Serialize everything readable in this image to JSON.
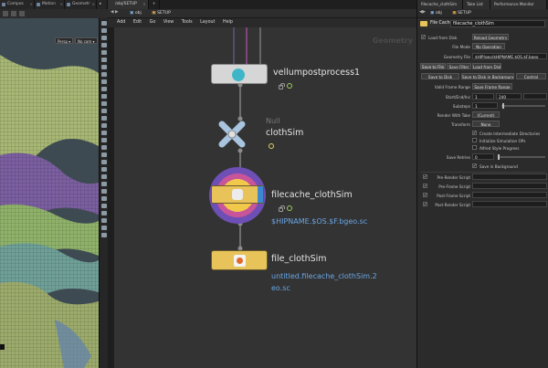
{
  "viewport": {
    "tabs": [
      {
        "label": "Compos"
      },
      {
        "label": "Motion"
      },
      {
        "label": "Geometr"
      }
    ],
    "persp_label": "Persp",
    "camera_label": "No cam",
    "colors": {
      "bg": "#3f4a52",
      "cloth_green": "#9bb067",
      "cloth_teal": "#6fa098",
      "cloth_purple": "#7b5fa0",
      "cloth_blue": "#5f80b0"
    }
  },
  "network": {
    "tabs": [
      {
        "label": "/obj/SETUP"
      },
      {
        "label": "+"
      }
    ],
    "path": {
      "root": "obj",
      "current": "SETUP"
    },
    "menu": [
      "Add",
      "Edit",
      "Go",
      "View",
      "Tools",
      "Layout",
      "Help"
    ],
    "context_label": "Geometry",
    "nodes": [
      {
        "name": "vellumpostprocess1",
        "type": "",
        "sub": "",
        "icon": "vellum-icon"
      },
      {
        "name": "clothSim",
        "type": "Null",
        "sub": "",
        "icon": "null-icon"
      },
      {
        "name": "filecache_clothSim",
        "type": "",
        "sub": "$HIPNAME.$OS.$F.bgeo.sc",
        "icon": "filecache-icon"
      },
      {
        "name": "file_clothSim",
        "type": "",
        "sub_line1": "untitled.filecache_clothSim.2",
        "sub_line2": "eo.sc",
        "icon": "file-icon"
      }
    ]
  },
  "params": {
    "tabs": [
      {
        "label": "filecache_clothSim"
      },
      {
        "label": "Take List"
      },
      {
        "label": "Performance Monitor"
      }
    ],
    "path": {
      "root": "obj",
      "current": "SETUP"
    },
    "node_type": "File Cache",
    "node_name": "filecache_clothSim",
    "load_from_disk": "Load from Disk",
    "reload_geometry": "Reload Geometry",
    "file_mode_label": "File Mode",
    "file_mode_value": "No Operation",
    "geometry_file_label": "Geometry File",
    "geometry_file_value": "$HIP/geo/$HIPNAME.$OS.$F.bgeo",
    "tabs2": [
      "Save to File",
      "Save Filter",
      "Load from Disk"
    ],
    "save_buttons": [
      "Save to Disk",
      "Save to Disk in Background",
      "Control"
    ],
    "valid_frame_range_label": "Valid Frame Range",
    "valid_frame_range_value": "Save Frame Range",
    "start_end_label": "Start/End/Inc",
    "start_value": "1",
    "end_value": "240",
    "substeps_label": "Substeps",
    "substeps_value": "1",
    "render_with_take_label": "Render With Take",
    "render_with_take_value": "(Current)",
    "transform_label": "Transform",
    "transform_value": "None",
    "checkboxes": [
      "Create Intermediate Directories",
      "Initialize Simulation OPs",
      "Alfred Style Progress"
    ],
    "save_retries_label": "Save Retries",
    "save_retries_value": "0",
    "save_in_background": "Save in Background",
    "scripts": [
      "Pre-Render Script",
      "Pre-Frame Script",
      "Post-Frame Script",
      "Post-Render Script"
    ]
  }
}
